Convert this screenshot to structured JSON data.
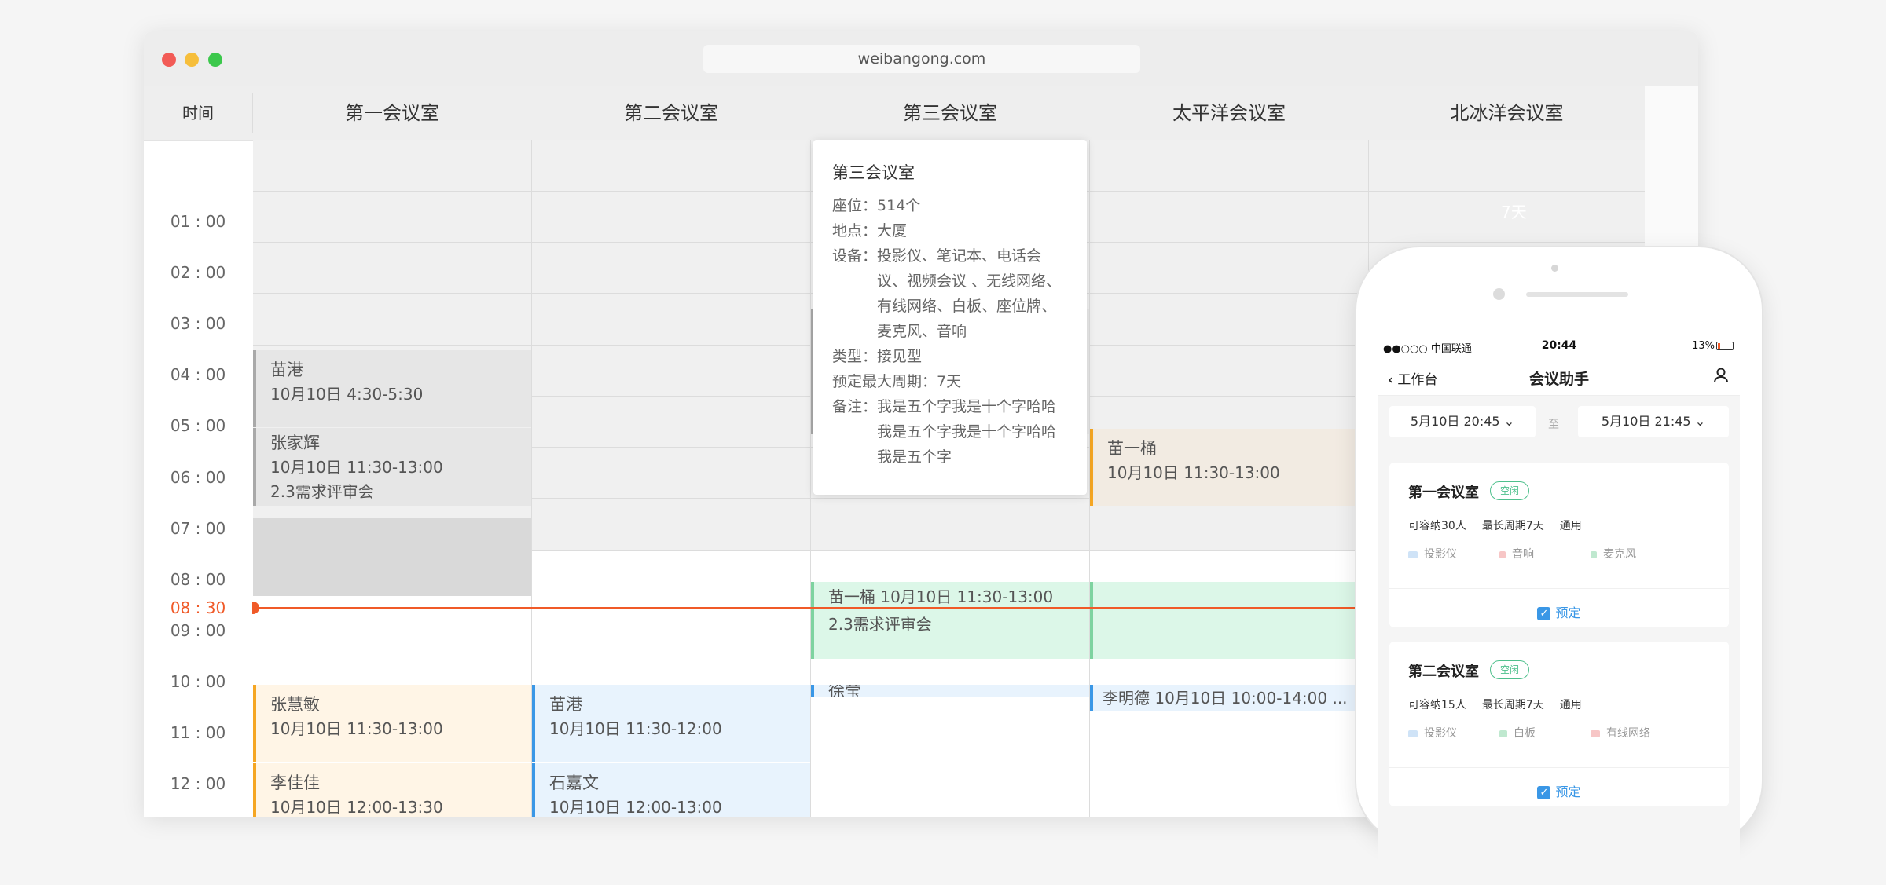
{
  "browser": {
    "url": "weibangong.com"
  },
  "header": {
    "time_label": "时间",
    "rooms": [
      "第一会议室",
      "第二会议室",
      "第三会议室",
      "太平洋会议室",
      "北冰洋会议室"
    ]
  },
  "times": [
    "01 : 00",
    "02 : 00",
    "03 : 00",
    "04 : 00",
    "05 : 00",
    "06 : 00",
    "07 : 00",
    "08 : 00",
    "09 : 00",
    "10 : 00",
    "11 : 00",
    "12 : 00"
  ],
  "now": {
    "label": "08 : 30"
  },
  "events": {
    "e1": {
      "name": "苗港",
      "time": "10月10日  4:30-5:30"
    },
    "e2": {
      "name": "张家辉",
      "time": "10月10日  11:30-13:00",
      "note": "2.3需求评审会"
    },
    "e3": {
      "name": "苗一桶",
      "time": "10月10日  11:30-13:00"
    },
    "e4": {
      "line1": "苗一桶    10月10日  11:30-13:00",
      "line2": "2.3需求评审会"
    },
    "e5": {
      "name": "张慧敏",
      "time": "10月10日  11:30-13:00"
    },
    "e6": {
      "name": "苗港",
      "time": "10月10日  11:30-12:00"
    },
    "e7": {
      "name": "李佳佳",
      "time": "10月10日  12:00-13:30"
    },
    "e8": {
      "name": "石嘉文",
      "time": "10月10日  12:00-13:00"
    },
    "e9": {
      "line1": "李明德  10月10日  10:00-14:00  ..."
    },
    "e10": {
      "name": "徐莹"
    },
    "north_tag": "7天"
  },
  "popup": {
    "title": "第三会议室",
    "seat": {
      "k": "座位：",
      "v": "514个"
    },
    "place": {
      "k": "地点：",
      "v": "大厦"
    },
    "equip": {
      "k": "设备：",
      "v": "投影仪、笔记本、电话会议、视频会议 、无线网络、有线网络、白板、座位牌、麦克风、音响"
    },
    "type": {
      "k": "类型：",
      "v": "接见型"
    },
    "period": {
      "k": "预定最大周期：",
      "v": "7天"
    },
    "remark": {
      "k": "备注：",
      "v": "我是五个字我是十个字哈哈我是五个字我是十个字哈哈我是五个字"
    }
  },
  "phone": {
    "status": {
      "carrier": "●●○○○ 中国联通",
      "time": "20:44",
      "battery": "13%"
    },
    "nav": {
      "back": "工作台",
      "title": "会议助手"
    },
    "date_from": "5月10日 20:45",
    "date_sep": "至",
    "date_to": "5月10日 21:45",
    "cards": [
      {
        "title": "第一会议室",
        "badge": "空闲",
        "capacity": "可容纳30人",
        "period": "最长周期7天",
        "scope": "通用",
        "equipment": [
          "投影仪",
          "音响",
          "麦克风"
        ],
        "book": "预定"
      },
      {
        "title": "第二会议室",
        "badge": "空闲",
        "capacity": "可容纳15人",
        "period": "最长周期7天",
        "scope": "通用",
        "equipment": [
          "投影仪",
          "白板",
          "有线网络"
        ],
        "book": "预定"
      }
    ]
  },
  "colors": {
    "accent_blue": "#3a97e6",
    "now_red": "#f05a28",
    "free_green": "#4fc08d",
    "orange": "#f5a623"
  }
}
